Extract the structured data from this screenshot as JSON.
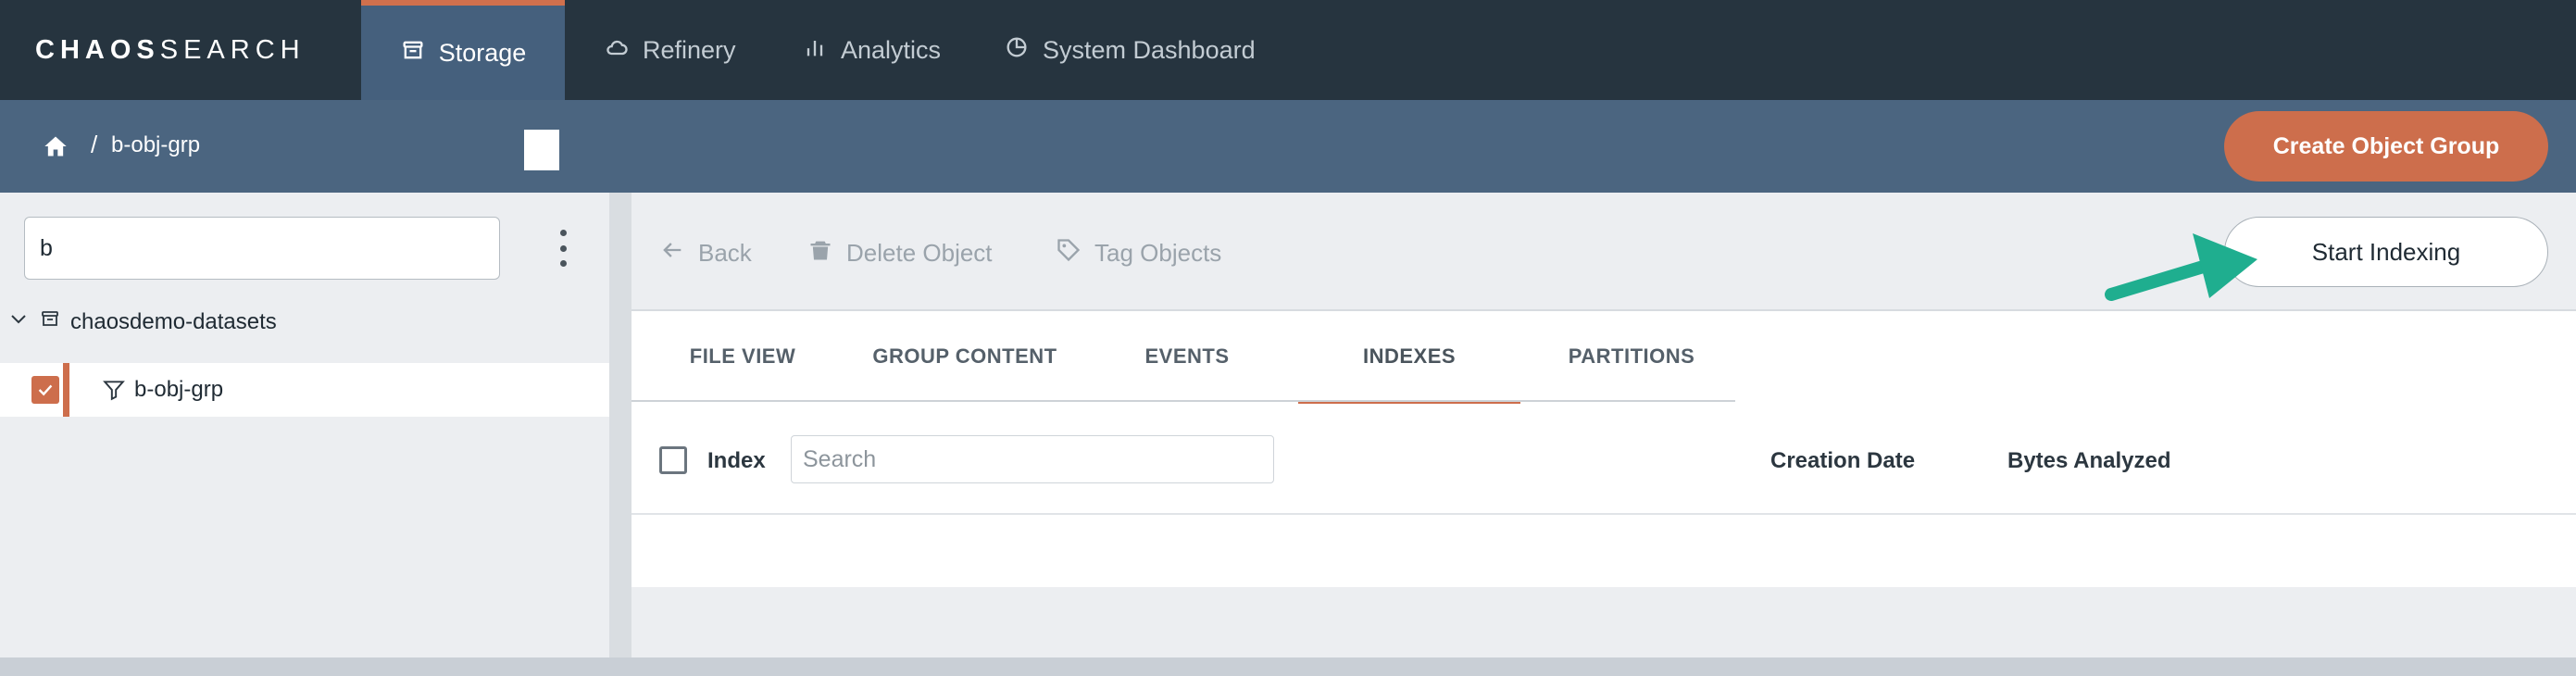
{
  "app": {
    "logo_bold": "CHAOS",
    "logo_light": "SEARCH"
  },
  "nav": {
    "tabs": [
      {
        "label": "Storage",
        "icon": "storage-icon",
        "active": true
      },
      {
        "label": "Refinery",
        "icon": "cloud-icon",
        "active": false
      },
      {
        "label": "Analytics",
        "icon": "bar-chart-icon",
        "active": false
      },
      {
        "label": "System Dashboard",
        "icon": "dashboard-icon",
        "active": false
      }
    ]
  },
  "breadcrumb": {
    "separator": "/",
    "current": "b-obj-grp"
  },
  "actions": {
    "create_label": "Create Object Group"
  },
  "sidebar": {
    "search_value": "b",
    "tree": {
      "root_label": "chaosdemo-datasets",
      "child_label": "b-obj-grp",
      "child_checked": true
    }
  },
  "toolbar": {
    "back_label": "Back",
    "delete_label": "Delete Object",
    "tag_label": "Tag Objects",
    "start_label": "Start Indexing"
  },
  "tabs": [
    {
      "label": "FILE VIEW",
      "active": false
    },
    {
      "label": "GROUP CONTENT",
      "active": false
    },
    {
      "label": "EVENTS",
      "active": false
    },
    {
      "label": "INDEXES",
      "active": true
    },
    {
      "label": "PARTITIONS",
      "active": false
    }
  ],
  "table": {
    "col_index": "Index",
    "search_placeholder": "Search",
    "col_creation_date": "Creation Date",
    "col_bytes": "Bytes Analyzed"
  },
  "colors": {
    "accent": "#cd6e4c",
    "nav_bg": "#26343f",
    "crumb_bg": "#4b6580",
    "annotation_arrow": "#1fae8f"
  }
}
